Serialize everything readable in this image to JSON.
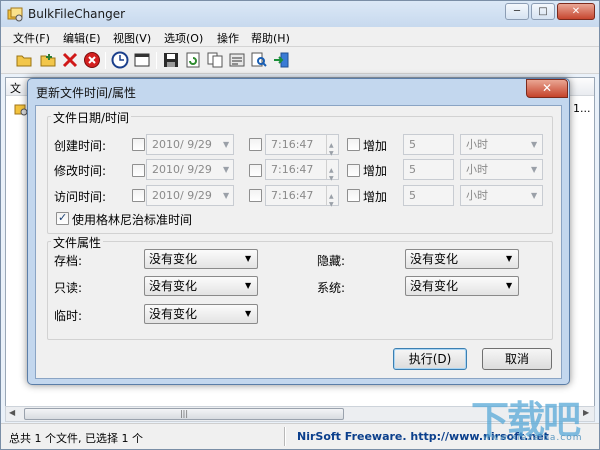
{
  "app": {
    "title": "BulkFileChanger",
    "window_buttons": {
      "minimize": "─",
      "maximize": "□",
      "close": "✕"
    }
  },
  "menu": [
    "文件(F)",
    "编辑(E)",
    "视图(V)",
    "选项(O)",
    "操作",
    "帮助(H)"
  ],
  "toolbar": {
    "icons": [
      "open-folder-icon",
      "add-files-icon",
      "delete-icon",
      "stop-icon",
      "clock-icon",
      "window-icon",
      "save-icon",
      "refresh-icon",
      "copy-icon",
      "properties-icon",
      "find-icon",
      "exit-icon"
    ]
  },
  "list": {
    "column_stub": "文",
    "trailing_text": "1..."
  },
  "status": {
    "left": "总共 1 个文件, 已选择 1 个",
    "right": "NirSoft Freeware.  http://www.nirsoft.net"
  },
  "watermark": {
    "text": "下载吧",
    "sub": "www.xiazaiba.com"
  },
  "dialog": {
    "title": "更新文件时间/属性",
    "close_label": "✕",
    "date_group": {
      "title": "文件日期/时间",
      "rows": [
        {
          "label": "创建时间:",
          "date": "2010/ 9/29",
          "time": "7:16:47",
          "add_label": "增加",
          "amount": "5",
          "unit": "小时"
        },
        {
          "label": "修改时间:",
          "date": "2010/ 9/29",
          "time": "7:16:47",
          "add_label": "增加",
          "amount": "5",
          "unit": "小时"
        },
        {
          "label": "访问时间:",
          "date": "2010/ 9/29",
          "time": "7:16:47",
          "add_label": "增加",
          "amount": "5",
          "unit": "小时"
        }
      ],
      "gmt_label": "使用格林尼治标准时间",
      "gmt_checked": true
    },
    "attr_group": {
      "title": "文件属性",
      "fields": [
        {
          "label": "存档:",
          "value": "没有变化"
        },
        {
          "label": "隐藏:",
          "value": "没有变化"
        },
        {
          "label": "只读:",
          "value": "没有变化"
        },
        {
          "label": "系统:",
          "value": "没有变化"
        },
        {
          "label": "临时:",
          "value": "没有变化"
        }
      ]
    },
    "buttons": {
      "ok": "执行(D)",
      "cancel": "取消"
    }
  },
  "colors": {
    "dialog_frame": "#c3d7ee",
    "accent": "#0b3f8c",
    "close_red": "#c5432b"
  }
}
